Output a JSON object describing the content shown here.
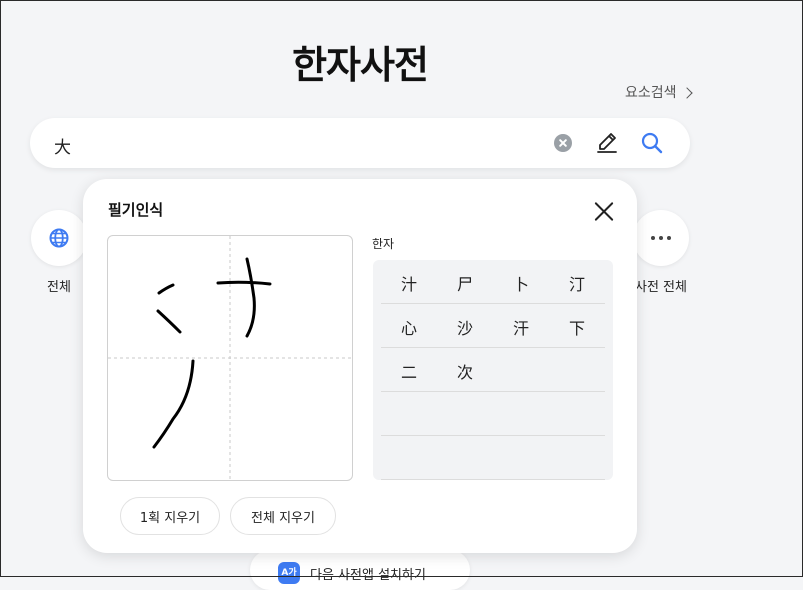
{
  "page": {
    "title": "한자사전"
  },
  "element_search": {
    "label": "요소검색"
  },
  "search": {
    "query": "大"
  },
  "categories": [
    {
      "label": "전체",
      "icon": "globe-icon"
    },
    {
      "label": "사전 전체",
      "icon": "more-icon"
    }
  ],
  "install": {
    "badge": "A가",
    "text": "다음 사전앱 설치하기"
  },
  "handwriting": {
    "title": "필기인식",
    "candidates_label": "한자",
    "candidates": [
      [
        "汁",
        "尸",
        "卜",
        "汀"
      ],
      [
        "心",
        "沙",
        "汗",
        "下"
      ],
      [
        "二",
        "次"
      ],
      [],
      []
    ],
    "undo_label": "1획 지우기",
    "clear_label": "전체 지우기"
  },
  "colors": {
    "accent": "#3e7bf2",
    "background": "#f4f5f7"
  }
}
